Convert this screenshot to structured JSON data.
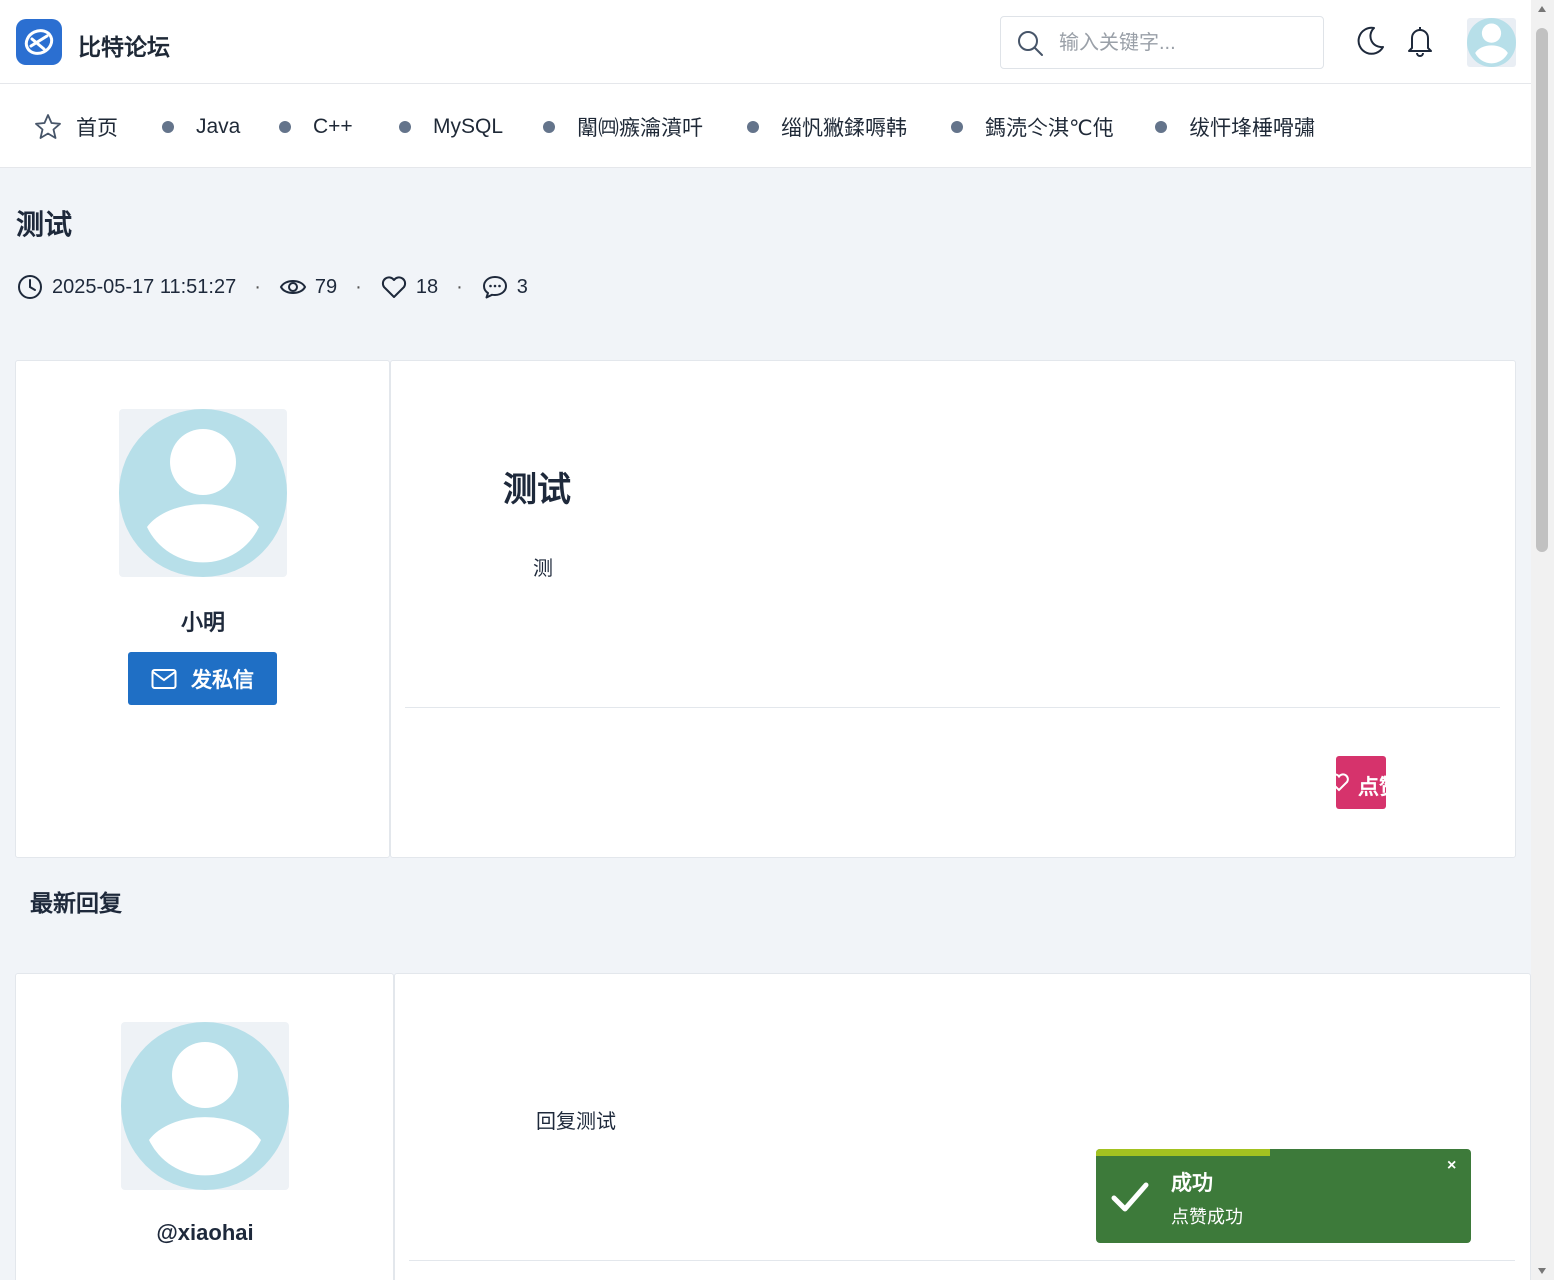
{
  "header": {
    "brand": "比特论坛",
    "search_placeholder": "输入关键字..."
  },
  "nav": {
    "items": [
      {
        "label": "首页",
        "icon": "star-icon"
      },
      {
        "label": "Java"
      },
      {
        "label": "C++"
      },
      {
        "label": "MySQL"
      },
      {
        "label": "闈㈣瘯瀹濆吀"
      },
      {
        "label": "缁忛獙鍒嗕韩"
      },
      {
        "label": "鎷涜仒淇℃伅"
      },
      {
        "label": "绂忓埄棰嗗彇"
      }
    ]
  },
  "post": {
    "title": "测试",
    "datetime": "2025-05-17 11:51:27",
    "views": "79",
    "likes": "18",
    "comments": "3",
    "body_heading": "测试",
    "body_text": "测",
    "like_label": "点赞"
  },
  "author": {
    "name": "小明",
    "message_label": "发私信"
  },
  "replies": {
    "section_title": "最新回复",
    "items": [
      {
        "user": "@xiaohai",
        "text": "回复测试"
      }
    ]
  },
  "toast": {
    "title": "成功",
    "message": "点赞成功",
    "close": "×"
  },
  "colors": {
    "primary": "#1f6fc5",
    "like": "#d6336c",
    "toast": "#3d7a3a",
    "toast_progress": "#a3c220",
    "avatar": "#b7dfe9"
  }
}
